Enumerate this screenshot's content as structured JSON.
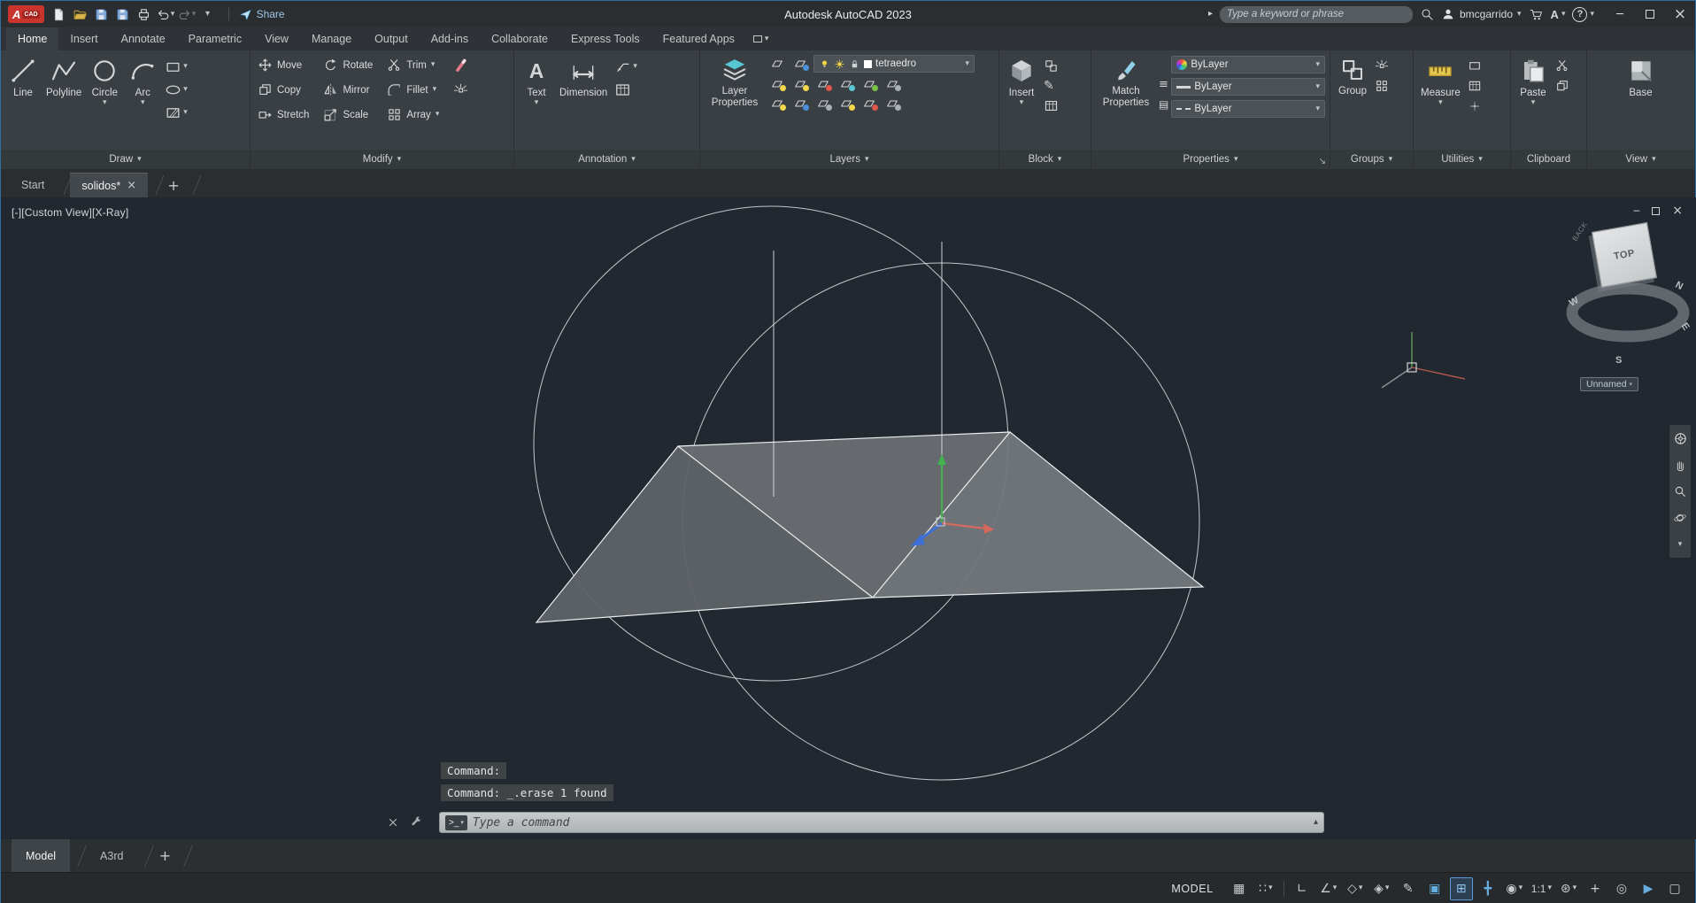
{
  "colors": {
    "accent_blue": "#4a90d9",
    "viewport_background": "#212830",
    "axis_red": "#d4695e",
    "axis_green": "#44b14e",
    "axis_blue": "#3e6fd6",
    "logo_red": "#c9342c"
  },
  "titlebar": {
    "app_title": "Autodesk AutoCAD 2023",
    "share_label": "Share",
    "search_placeholder": "Type a keyword or phrase",
    "username": "bmcgarrido"
  },
  "ribbon": {
    "tabs": [
      "Home",
      "Insert",
      "Annotate",
      "Parametric",
      "View",
      "Manage",
      "Output",
      "Add-ins",
      "Collaborate",
      "Express Tools",
      "Featured Apps"
    ]
  },
  "panels": {
    "draw": {
      "label": "Draw",
      "buttons": [
        "Line",
        "Polyline",
        "Circle",
        "Arc"
      ]
    },
    "modify": {
      "label": "Modify",
      "buttons": [
        "Move",
        "Rotate",
        "Trim",
        "Copy",
        "Mirror",
        "Fillet",
        "Stretch",
        "Scale",
        "Array"
      ]
    },
    "annotation": {
      "label": "Annotation",
      "buttons": [
        "Text",
        "Dimension"
      ]
    },
    "layers": {
      "label": "Layers",
      "button": "Layer Properties",
      "current_layer": "tetraedro"
    },
    "block": {
      "label": "Block",
      "button": "Insert"
    },
    "properties": {
      "label": "Properties",
      "button": "Match Properties",
      "color": "ByLayer",
      "lineweight": "ByLayer",
      "linetype": "ByLayer"
    },
    "groups": {
      "label": "Groups",
      "button": "Group"
    },
    "utilities": {
      "label": "Utilities",
      "button": "Measure"
    },
    "clipboard": {
      "label": "Clipboard",
      "button": "Paste"
    },
    "view": {
      "label": "View",
      "button": "Base"
    }
  },
  "file_tabs": {
    "start": "Start",
    "drawing": "solidos*"
  },
  "viewport": {
    "view_label": "[-][Custom View][X-Ray]",
    "viewcube": {
      "top": "TOP",
      "back": "BACK",
      "w": "W",
      "n": "N",
      "e": "E",
      "s": "S",
      "named_view": "Unnamed"
    }
  },
  "command_line": {
    "history_1": "Command:",
    "history_2": "Command: _.erase 1 found",
    "placeholder": "Type a command"
  },
  "layout_tabs": {
    "model": "Model",
    "sheet": "A3rd"
  },
  "status_bar": {
    "space": "MODEL",
    "annotation_scale": "1:1"
  }
}
